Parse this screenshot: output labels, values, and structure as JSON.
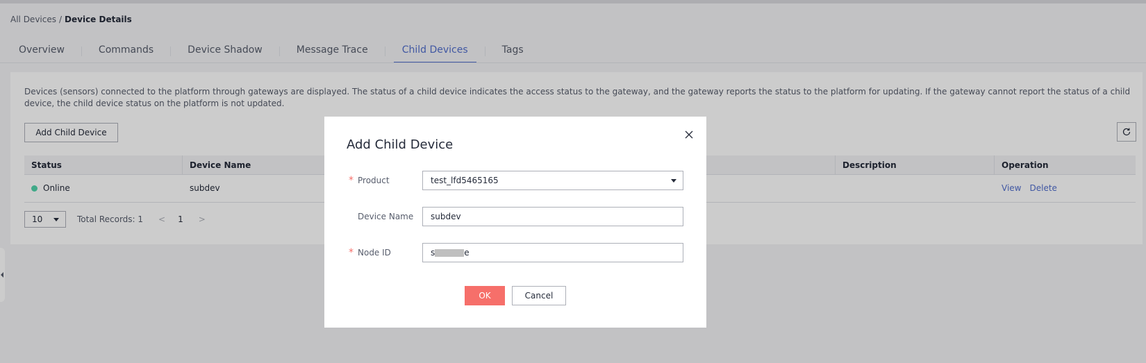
{
  "breadcrumb": {
    "parent": "All Devices",
    "separator": "/",
    "current": "Device Details"
  },
  "tabs": [
    {
      "label": "Overview",
      "active": false
    },
    {
      "label": "Commands",
      "active": false
    },
    {
      "label": "Device Shadow",
      "active": false
    },
    {
      "label": "Message Trace",
      "active": false
    },
    {
      "label": "Child Devices",
      "active": true
    },
    {
      "label": "Tags",
      "active": false
    }
  ],
  "content": {
    "description": "Devices (sensors) connected to the platform through gateways are displayed. The status of a child device indicates the access status to the gateway, and the gateway reports the status to the platform for updating. If the gateway cannot report the status of a child device, the child device status on the platform is not updated.",
    "add_button": "Add Child Device",
    "refresh_icon": "refresh-icon"
  },
  "table": {
    "columns": [
      "Status",
      "Device Name",
      "",
      "",
      "Description",
      "Operation"
    ],
    "rows": [
      {
        "status": "Online",
        "status_color": "#50d4ab",
        "device_name": "subdev",
        "col3": "",
        "col4": "",
        "description": "",
        "actions": [
          "View",
          "Delete"
        ]
      }
    ]
  },
  "pager": {
    "page_size": "10",
    "total": "Total Records: 1",
    "prev": "<",
    "page": "1",
    "next": ">"
  },
  "modal": {
    "title": "Add Child Device",
    "fields": {
      "product": {
        "label": "Product",
        "value": "test_lfd5465165",
        "required": true
      },
      "device_name": {
        "label": "Device Name",
        "value": "subdev",
        "required": false
      },
      "node_id": {
        "label": "Node ID",
        "value_prefix": "s",
        "value_suffix": "e",
        "required": true
      }
    },
    "required_mark": "*",
    "ok": "OK",
    "cancel": "Cancel"
  },
  "colors": {
    "accent": "#526ecc",
    "primary_button": "#f66f6a",
    "online": "#50d4ab"
  }
}
